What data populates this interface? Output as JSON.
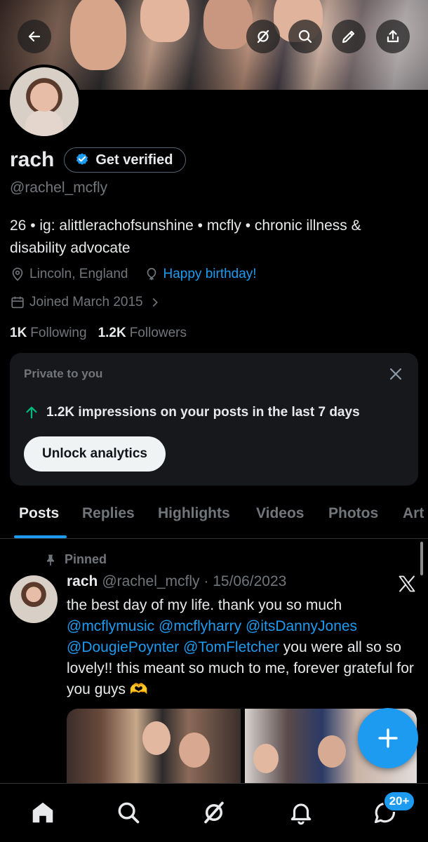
{
  "profile": {
    "name": "rach",
    "verify_label": "Get verified",
    "handle": "@rachel_mcfly",
    "bio": "26 • ig: alittlerachofsunshine • mcfly • chronic illness & disability advocate",
    "location": "Lincoln, England",
    "birthday": "Happy birthday!",
    "joined": "Joined March 2015",
    "following_count": "1K",
    "following_label": "Following",
    "followers_count": "1.2K",
    "followers_label": "Followers"
  },
  "private_card": {
    "title": "Private to you",
    "impressions": "1.2K impressions on your posts in the last 7 days",
    "button": "Unlock analytics"
  },
  "tabs": [
    "Posts",
    "Replies",
    "Highlights",
    "Videos",
    "Photos",
    "Art"
  ],
  "post": {
    "pinned_label": "Pinned",
    "author": "rach",
    "handle_date": "@rachel_mcfly · 15/06/2023",
    "text_1": "the best day of my life. thank you so much",
    "mention_1": "@mcflymusic",
    "mention_2": "@mcflyharry",
    "mention_3": "@itsDannyJones",
    "mention_4": "@DougiePoynter",
    "mention_5": "@TomFletcher",
    "text_2": "you were all so so lovely!! this meant so much to me, forever grateful for you guys",
    "emoji": "🫶"
  },
  "nav": {
    "messages_badge": "20+"
  },
  "colors": {
    "accent": "#1d9bf0",
    "background": "#000000",
    "up_arrow": "#00ba7c"
  },
  "icons": [
    "back-arrow-icon",
    "grok-icon",
    "search-icon",
    "edit-icon",
    "share-icon",
    "verified-badge-icon",
    "location-icon",
    "balloon-icon",
    "calendar-icon",
    "chevron-right-icon",
    "close-icon",
    "arrow-up-icon",
    "pin-icon",
    "x-logo-icon",
    "plus-icon",
    "home-icon",
    "messages-icon",
    "bell-icon"
  ]
}
